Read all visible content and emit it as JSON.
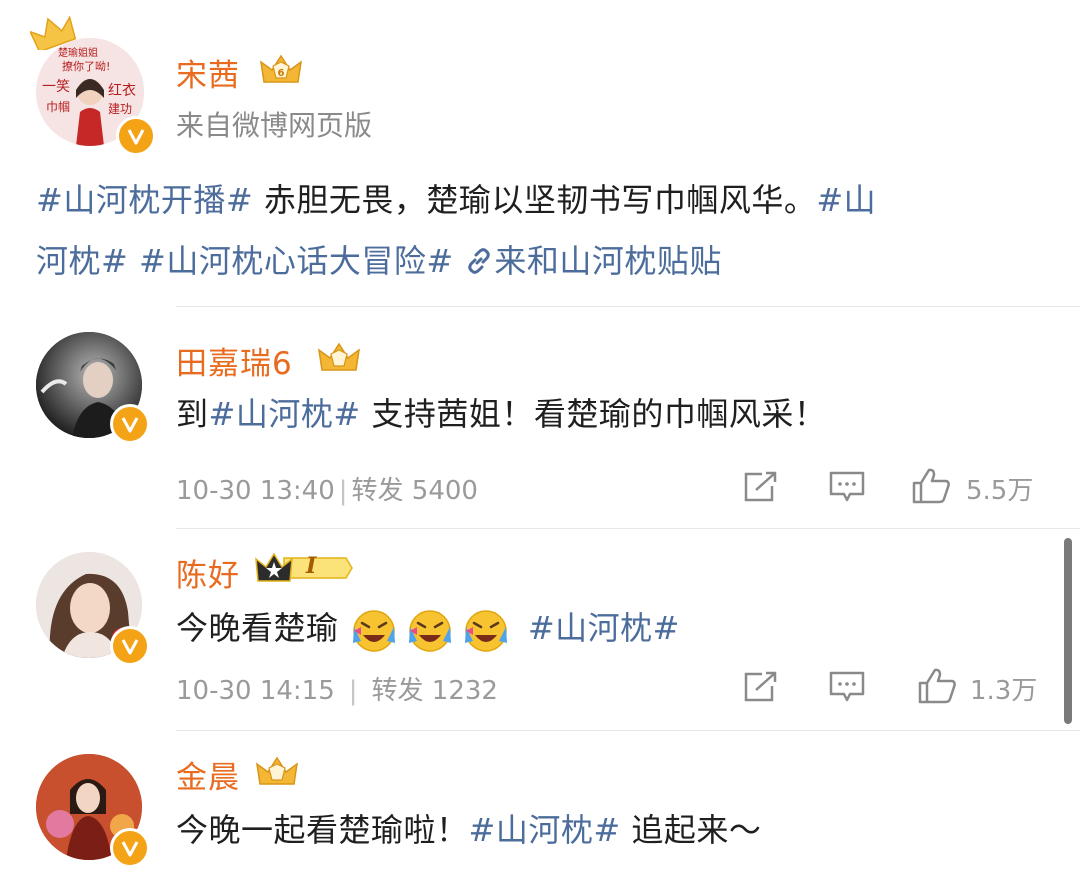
{
  "post": {
    "author": "宋茜",
    "source": "来自微博网页版",
    "avatar_words": [
      "楚瑜姐姐",
      "撩你了呦!",
      "一笑",
      "红衣",
      "巾帼",
      "建功"
    ],
    "text": {
      "tag1": "#山河枕开播#",
      "plain": " 赤胆无畏，楚瑜以坚韧书写巾帼风华。",
      "tag2_line1": "#山",
      "tag2_line2": "河枕#",
      "tag3": " #山河枕心话大冒险#",
      "link": "来和山河枕贴贴"
    }
  },
  "comments": [
    {
      "author": "田嘉瑞6",
      "pre": "到",
      "tag": "#山河枕#",
      "post": " 支持茜姐！看楚瑜的巾帼风采！",
      "time": "10-30 13:40",
      "repost": "转发 5400",
      "likes": "5.5万"
    },
    {
      "author": "陈好",
      "badge_letter": "I",
      "pre": "今晚看楚瑜",
      "tag": "#山河枕#",
      "time": "10-30 14:15",
      "repost": "转发 1232",
      "likes": "1.3万"
    },
    {
      "author": "金晨",
      "pre": "今晚一起看楚瑜啦！",
      "tag": "#山河枕#",
      "post": " 追起来～"
    }
  ],
  "colors": {
    "name": "#e86b1f",
    "tag": "#4c6d9c",
    "meta": "#9a9a9a",
    "verify": "#f4a316"
  }
}
